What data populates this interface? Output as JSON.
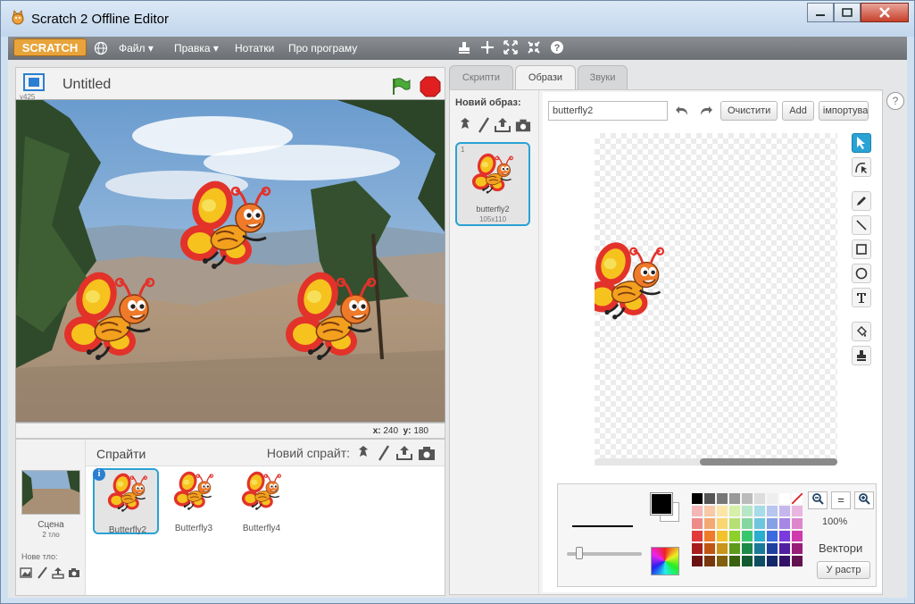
{
  "window": {
    "title": "Scratch 2 Offline Editor"
  },
  "menu": {
    "logo": "SCRATCH",
    "items": [
      "Файл ▾",
      "Правка ▾",
      "Нотатки",
      "Про програму"
    ],
    "tools": [
      "stamp-icon",
      "cut-icon",
      "grow-icon",
      "shrink-icon",
      "help-icon"
    ]
  },
  "stage": {
    "project_title": "Untitled",
    "version": "v425",
    "x_label": "x:",
    "x_value": "240",
    "y_label": "y:",
    "y_value": "180"
  },
  "sprites": {
    "header": "Спрайти",
    "new_sprite": "Новий спрайт:",
    "scene_label": "Сцена",
    "scene_sub": "2 тло",
    "new_bg": "Нове тло:",
    "items": [
      {
        "name": "Butterfly2",
        "selected": true
      },
      {
        "name": "Butterfly3",
        "selected": false
      },
      {
        "name": "Butterfly4",
        "selected": false
      }
    ]
  },
  "tabs": [
    {
      "label": "Скрипти",
      "active": false
    },
    {
      "label": "Образи",
      "active": true
    },
    {
      "label": "Звуки",
      "active": false
    }
  ],
  "costumes": {
    "new_label": "Новий образ:",
    "items": [
      {
        "num": "1",
        "name": "butterfly2",
        "size": "105x110"
      }
    ]
  },
  "paint": {
    "name_value": "butterfly2",
    "clear": "Очистити",
    "add": "Add",
    "import": "імпортувати",
    "zoom": "100%",
    "mode": "Вектори",
    "convert": "У растр",
    "primary_color": "#000000",
    "secondary_color": "#ffffff"
  },
  "palette": [
    "#000000",
    "#555555",
    "#777777",
    "#999999",
    "#bbbbbb",
    "#dddddd",
    "#eeeeee",
    "#ffffff",
    "none",
    "#f4b6b6",
    "#f7c9a6",
    "#fbe6a6",
    "#d6f0a6",
    "#b6e6c6",
    "#a6dbe8",
    "#b6c6ee",
    "#c6b6ee",
    "#e8b6e0",
    "#ee8a8a",
    "#f4a872",
    "#f8d672",
    "#b6e072",
    "#86d6a0",
    "#6ec6de",
    "#86a0e6",
    "#a686e6",
    "#de86cc",
    "#e03a3a",
    "#ee7a2a",
    "#f4c22a",
    "#8ed02a",
    "#3ac66e",
    "#2aaed0",
    "#3a6ade",
    "#7a3ade",
    "#d03aae",
    "#a81e1e",
    "#c05614",
    "#c8961a",
    "#5e9a1a",
    "#1e8a4a",
    "#1a7a98",
    "#1e40a0",
    "#501ea0",
    "#981e78",
    "#6a1212",
    "#7a360c",
    "#80600e",
    "#3a620e",
    "#125a30",
    "#0e4e62",
    "#122868",
    "#321268",
    "#62124e"
  ]
}
